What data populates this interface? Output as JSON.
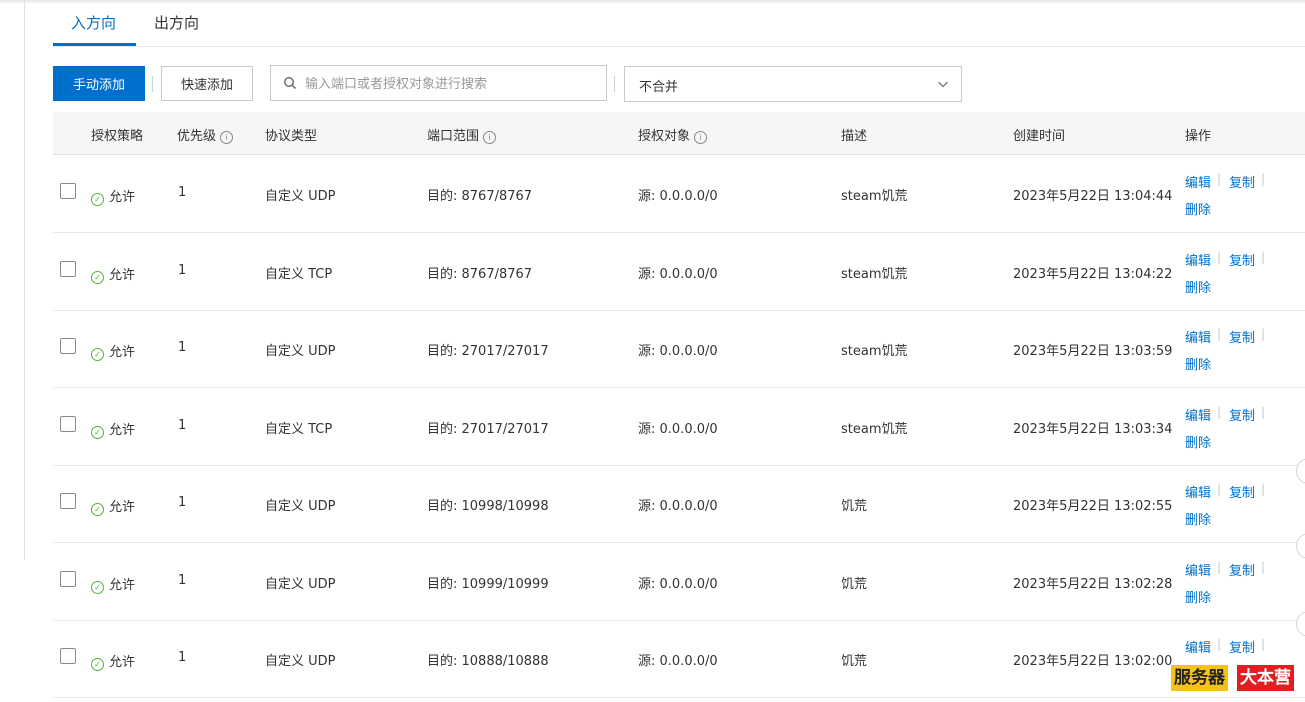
{
  "tabs": [
    {
      "label": "入方向",
      "active": true
    },
    {
      "label": "出方向",
      "active": false
    }
  ],
  "toolbar": {
    "manual_add": "手动添加",
    "quick_add": "快速添加",
    "search_placeholder": "输入端口或者授权对象进行搜索",
    "merge_select": "不合并"
  },
  "table": {
    "headers": {
      "policy": "授权策略",
      "priority": "优先级",
      "protocol": "协议类型",
      "port": "端口范围",
      "target": "授权对象",
      "desc": "描述",
      "created": "创建时间",
      "ops": "操作"
    },
    "rows": [
      {
        "policy": "允许",
        "priority": "1",
        "protocol": "自定义 UDP",
        "port": "目的: 8767/8767",
        "source": "源: 0.0.0.0/0",
        "desc": "steam饥荒",
        "created": "2023年5月22日 13:04:44"
      },
      {
        "policy": "允许",
        "priority": "1",
        "protocol": "自定义 TCP",
        "port": "目的: 8767/8767",
        "source": "源: 0.0.0.0/0",
        "desc": "steam饥荒",
        "created": "2023年5月22日 13:04:22"
      },
      {
        "policy": "允许",
        "priority": "1",
        "protocol": "自定义 UDP",
        "port": "目的: 27017/27017",
        "source": "源: 0.0.0.0/0",
        "desc": "steam饥荒",
        "created": "2023年5月22日 13:03:59"
      },
      {
        "policy": "允许",
        "priority": "1",
        "protocol": "自定义 TCP",
        "port": "目的: 27017/27017",
        "source": "源: 0.0.0.0/0",
        "desc": "steam饥荒",
        "created": "2023年5月22日 13:03:34"
      },
      {
        "policy": "允许",
        "priority": "1",
        "protocol": "自定义 UDP",
        "port": "目的: 10998/10998",
        "source": "源: 0.0.0.0/0",
        "desc": "饥荒",
        "created": "2023年5月22日 13:02:55"
      },
      {
        "policy": "允许",
        "priority": "1",
        "protocol": "自定义 UDP",
        "port": "目的: 10999/10999",
        "source": "源: 0.0.0.0/0",
        "desc": "饥荒",
        "created": "2023年5月22日 13:02:28"
      },
      {
        "policy": "允许",
        "priority": "1",
        "protocol": "自定义 UDP",
        "port": "目的: 10888/10888",
        "source": "源: 0.0.0.0/0",
        "desc": "饥荒",
        "created": "2023年5月22日 13:02:00"
      }
    ],
    "actions": {
      "edit": "编辑",
      "copy": "复制",
      "delete": "删除"
    }
  },
  "watermark": {
    "part1": "服务器",
    "part2": "大本营"
  },
  "colors": {
    "accent": "#0070cc",
    "allow_green": "#52b330",
    "header_bg": "#f4f6f8"
  },
  "icons": {
    "search": "search-icon",
    "chevron": "chevron-down-icon",
    "info": "info-icon",
    "allow": "check-circle-icon"
  }
}
